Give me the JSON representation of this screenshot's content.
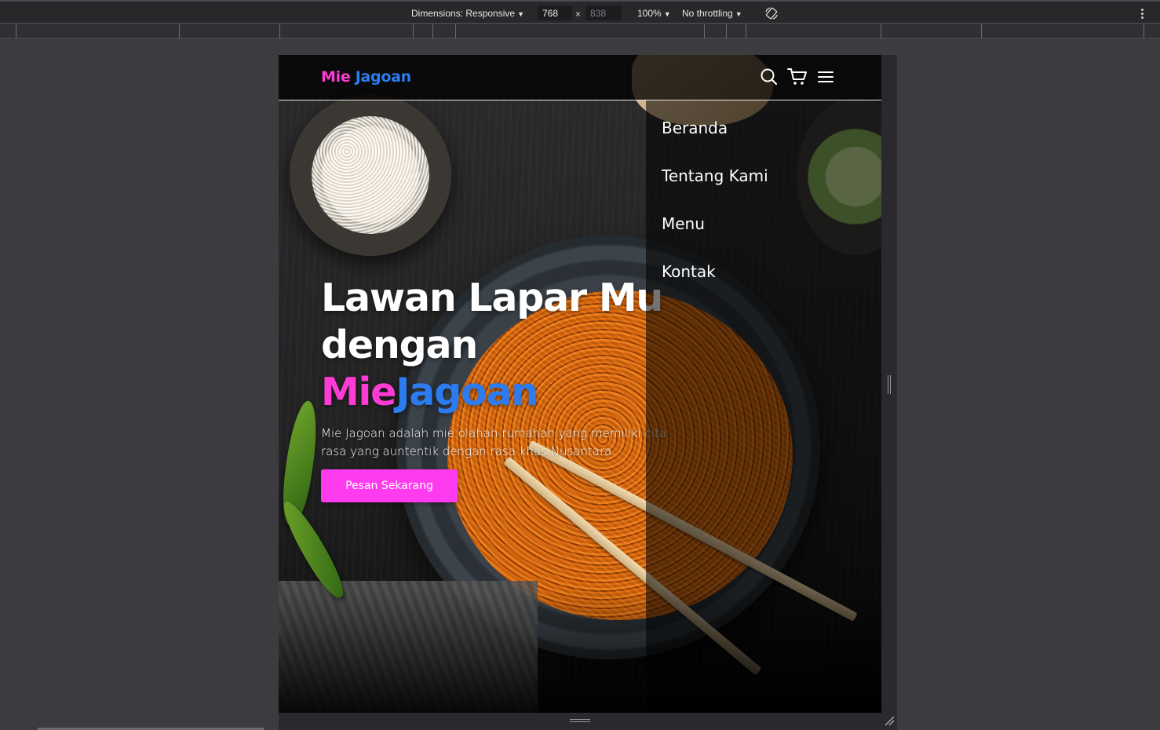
{
  "devtools": {
    "dimensions_label": "Dimensions: Responsive",
    "width_value": "768",
    "height_placeholder": "838",
    "times_symbol": "×",
    "zoom_label": "100%",
    "throttling_label": "No throttling",
    "caret": "▼"
  },
  "site": {
    "logo_part1": "Mie",
    "logo_part2": "Jagoan",
    "nav_links": [
      "Beranda",
      "Tentang Kami",
      "Menu",
      "Kontak"
    ],
    "hero": {
      "title_line1": "Lawan Lapar Mu",
      "title_line2": "dengan",
      "title_highlight_mie": "Mie",
      "title_highlight_jagoan": "Jagoan",
      "description": "Mie Jagoan adalah mie olahan rumahan yang memiliki cita rasa yang auntentik dengan rasa khas Nusantara.",
      "cta_label": "Pesan Sekarang"
    },
    "colors": {
      "accent_pink": "#ff3bd6",
      "accent_blue": "#2c7cf0",
      "button_pink": "#ff3bf0"
    },
    "icons": [
      "search-icon",
      "cart-icon",
      "hamburger-menu-icon"
    ]
  }
}
